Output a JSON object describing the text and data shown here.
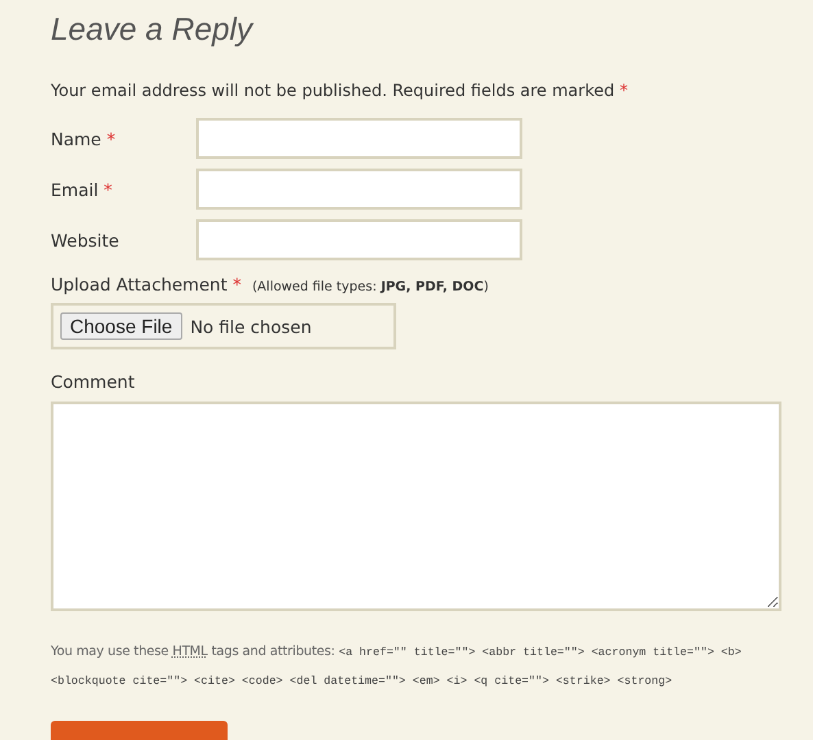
{
  "heading": "Leave a Reply",
  "notice": {
    "text": "Your email address will not be published. Required fields are marked",
    "required_mark": "*"
  },
  "fields": [
    {
      "kind": "text",
      "label": "Name",
      "required_mark": "*"
    },
    {
      "kind": "text",
      "label": "Email",
      "required_mark": "*"
    },
    {
      "kind": "text",
      "label": "Website"
    }
  ],
  "upload": {
    "label": "Upload Attachement",
    "required_mark": "*",
    "hint": "(Allowed file types: **JPG, PDF, DOC**)",
    "button": "Choose File",
    "status": "No file chosen"
  },
  "comment": {
    "label": "Comment"
  },
  "allowed_tags": {
    "prefix": "You may use these",
    "abbr": "HTML",
    "suffix": "tags and attributes:",
    "code": "<a href=\"\" title=\"\"> <abbr title=\"\"> <acronym title=\"\"> <b> <blockquote cite=\"\"> <cite> <code> <del datetime=\"\"> <em> <i> <q cite=\"\"> <strike> <strong>"
  }
}
